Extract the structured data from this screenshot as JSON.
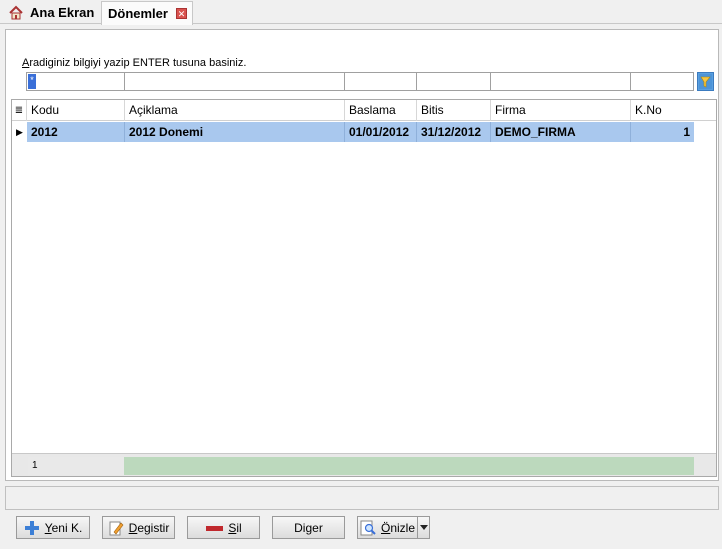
{
  "tabs": {
    "home_label": "Ana Ekran",
    "active_label": "Dönemler",
    "close_glyph": "✕"
  },
  "search": {
    "hint": "Aradiginiz bilgiyi yazip ENTER tusuna basiniz.",
    "hint_first_letter": "A",
    "hint_rest": "radiginiz bilgiyi yazip ENTER tusuna basiniz.",
    "filter_first_value": "*",
    "filter_icon": "filter-icon"
  },
  "grid": {
    "indicator_icon": "≣",
    "columns": [
      "Kodu",
      "Açiklama",
      "Baslama",
      "Bitis",
      "Firma",
      "K.No"
    ],
    "rows": [
      {
        "kodu": "2012",
        "aciklama": "2012 Donemi",
        "baslama": "01/01/2012",
        "bitis": "31/12/2012",
        "firma": "DEMO_FIRMA",
        "kno": "1"
      }
    ],
    "record_count": "1"
  },
  "toolbar": {
    "yeni_first": "Y",
    "yeni_rest": "eni K.",
    "degistir_first": "D",
    "degistir_rest": "egistir",
    "sil_first": "S",
    "sil_rest": "il",
    "diger_pre": "Di",
    "diger_u": "g",
    "diger_post": "er",
    "onizle_first": "Ö",
    "onizle_rest": "nizle"
  },
  "colors": {
    "selection": "#a9c8ee",
    "footer_fill": "#bcd9bd",
    "sil_icon": "#c0282d",
    "yeni_icon": "#3c7fd6"
  }
}
